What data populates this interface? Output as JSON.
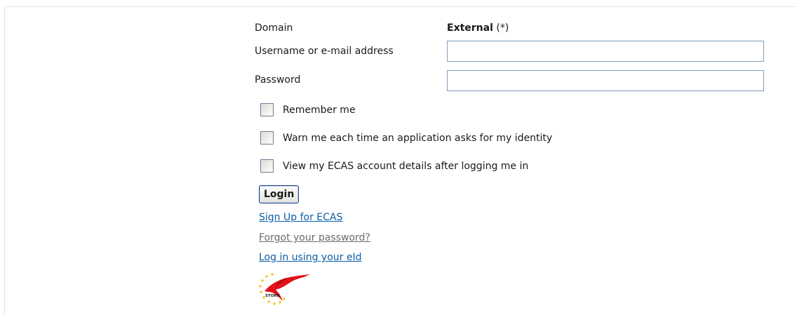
{
  "domain_row": {
    "label": "Domain",
    "value_bold": "External",
    "value_suffix": " (*)"
  },
  "username": {
    "label": "Username or e-mail address",
    "value": ""
  },
  "password": {
    "label": "Password",
    "value": ""
  },
  "checkboxes": [
    {
      "label": "Remember me",
      "checked": false
    },
    {
      "label": "Warn me each time an application asks for my identity",
      "checked": false
    },
    {
      "label": "View my ECAS account details after logging me in",
      "checked": false
    }
  ],
  "login_button": "Login",
  "links": {
    "signup": "Sign Up for ECAS",
    "forgot": "Forgot your password?",
    "eid": "Log in using your eId"
  },
  "stork_logo": {
    "text": "STORK",
    "icon": "stork-logo-icon"
  },
  "colors": {
    "link_blue": "#0a5ea8",
    "link_gray": "#6a6a6a",
    "logo_red": "#e2121b",
    "logo_star": "#f2c200"
  }
}
